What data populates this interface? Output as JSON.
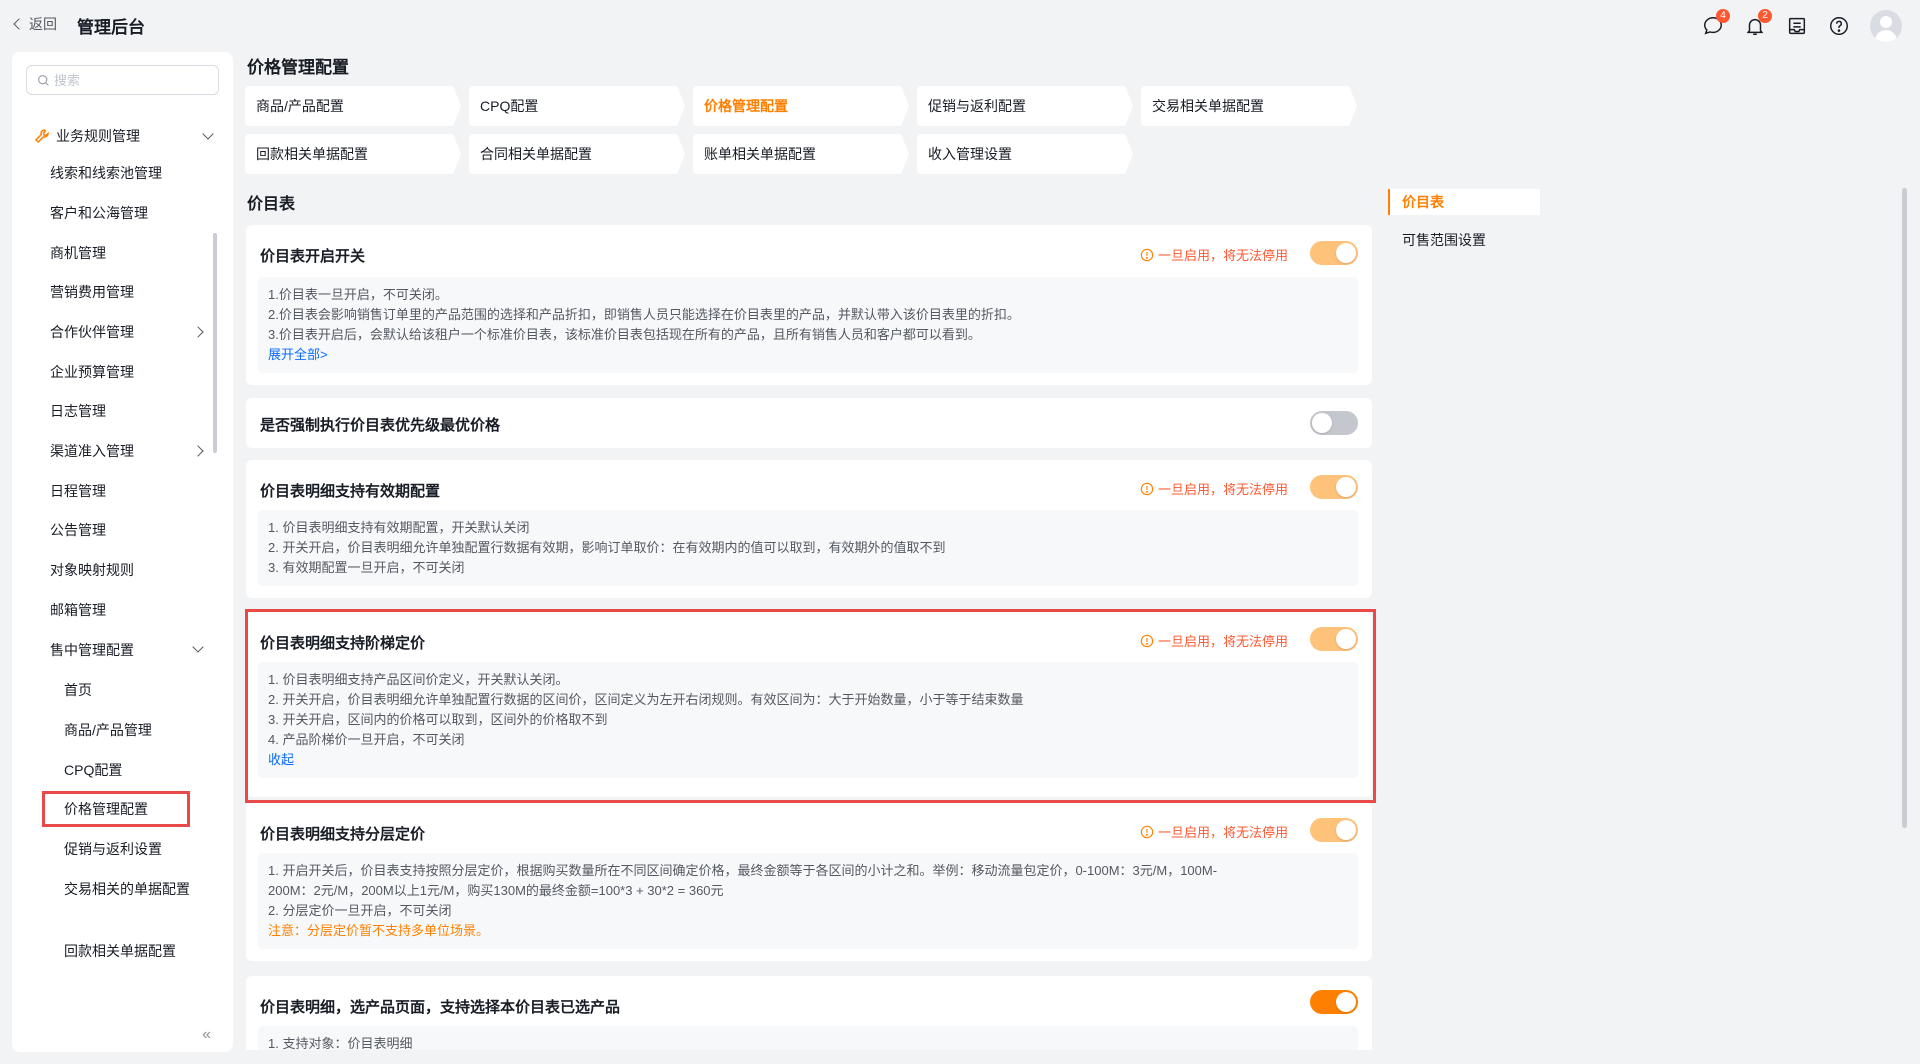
{
  "header": {
    "back_label": "返回",
    "app_title": "管理后台",
    "icons": [
      {
        "name": "message-icon",
        "badge": "4"
      },
      {
        "name": "bell-icon",
        "badge": "2"
      },
      {
        "name": "inbox-icon",
        "badge": ""
      },
      {
        "name": "help-icon",
        "badge": ""
      }
    ]
  },
  "sidebar": {
    "search_placeholder": "搜索",
    "group_label": "业务规则管理",
    "items": [
      {
        "label": "线索和线索池管理"
      },
      {
        "label": "客户和公海管理"
      },
      {
        "label": "商机管理"
      },
      {
        "label": "营销费用管理"
      },
      {
        "label": "合作伙伴管理"
      },
      {
        "label": "企业预算管理"
      },
      {
        "label": "日志管理"
      },
      {
        "label": "渠道准入管理"
      },
      {
        "label": "日程管理"
      },
      {
        "label": "公告管理"
      },
      {
        "label": "对象映射规则"
      },
      {
        "label": "邮箱管理"
      },
      {
        "label": "售中管理配置"
      }
    ],
    "sub_items": [
      {
        "label": "首页"
      },
      {
        "label": "商品/产品管理"
      },
      {
        "label": "CPQ配置"
      },
      {
        "label": "价格管理配置"
      },
      {
        "label": "促销与返利设置"
      },
      {
        "label": "交易相关的单据配置"
      },
      {
        "label": "回款相关单据配置"
      }
    ],
    "collapse_label": "«"
  },
  "main": {
    "page_title": "价格管理配置",
    "tabs": [
      {
        "label": "商品/产品配置"
      },
      {
        "label": "CPQ配置"
      },
      {
        "label": "价格管理配置"
      },
      {
        "label": "促销与返利配置"
      },
      {
        "label": "交易相关单据配置"
      },
      {
        "label": "回款相关单据配置"
      },
      {
        "label": "合同相关单据配置"
      },
      {
        "label": "账单相关单据配置"
      },
      {
        "label": "收入管理设置"
      }
    ],
    "active_tab": "价格管理配置",
    "section_title": "价目表",
    "warn_text": "一旦启用，将无法停用",
    "cards": [
      {
        "title": "价目表开启开关",
        "state": "on-disabled",
        "lines": [
          "1.价目表一旦开启，不可关闭。",
          "2.价目表会影响销售订单里的产品范围的选择和产品折扣，即销售人员只能选择在价目表里的产品，并默认带入该价目表里的折扣。",
          "3.价目表开启后，会默认给该租户一个标准价目表，该标准价目表包括现在所有的产品，且所有销售人员和客户都可以看到。"
        ],
        "link": "展开全部>"
      },
      {
        "title": "是否强制执行价目表优先级最优价格",
        "state": "off"
      },
      {
        "title": "价目表明细支持有效期配置",
        "state": "on-disabled",
        "lines": [
          "1. 价目表明细支持有效期配置，开关默认关闭",
          "2. 开关开启，价目表明细允许单独配置行数据有效期，影响订单取价：在有效期内的值可以取到，有效期外的值取不到",
          "3. 有效期配置一旦开启，不可关闭"
        ]
      },
      {
        "title": "价目表明细支持阶梯定价",
        "state": "on-disabled",
        "lines": [
          "1. 价目表明细支持产品区间价定义，开关默认关闭。",
          "2. 开关开启，价目表明细允许单独配置行数据的区间价，区间定义为左开右闭规则。有效区间为：大于开始数量，小于等于结束数量",
          "3. 开关开启，区间内的价格可以取到，区间外的价格取不到",
          "4. 产品阶梯价一旦开启，不可关闭"
        ],
        "link": "收起"
      },
      {
        "title": "价目表明细支持分层定价",
        "state": "on-disabled",
        "lines": [
          "1. 开启开关后，价目表支持按照分层定价，根据购买数量所在不同区间确定价格，最终金额等于各区间的小计之和。举例：移动流量包定价，0-100M：3元/M，100M-",
          "200M：2元/M，200M以上1元/M，购买130M的最终金额=100*3 + 30*2 = 360元",
          "2. 分层定价一旦开启，不可关闭"
        ],
        "note": "注意：分层定价暂不支持多单位场景。"
      },
      {
        "title": "价目表明细，选产品页面，支持选择本价目表已选产品",
        "state": "on",
        "lines": [
          "1. 支持对象：价目表明细"
        ]
      }
    ]
  },
  "anchor": {
    "items": [
      {
        "label": "价目表"
      },
      {
        "label": "可售范围设置"
      }
    ]
  },
  "colors": {
    "accent": "#ff8000",
    "warn": "#ff5730",
    "link": "#0c6cff",
    "highlight": "#e84a4a"
  }
}
